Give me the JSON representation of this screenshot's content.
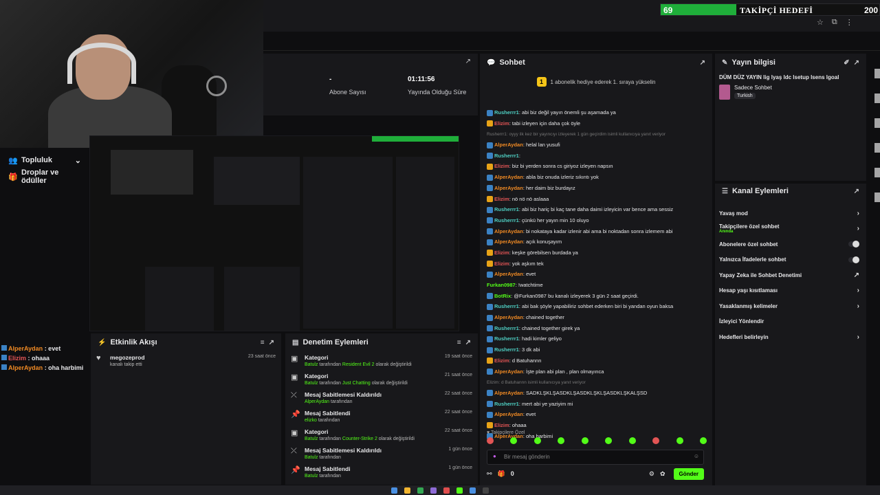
{
  "goal": {
    "current": "69",
    "title": "TAKİPÇİ HEDEFİ",
    "target": "200",
    "progress_fraction": 0.345,
    "color": "#1fae3a"
  },
  "stats": [
    {
      "value": "-",
      "label": "Abone Sayısı"
    },
    {
      "value": "01:11:56",
      "label": "Yayında Olduğu Süre"
    }
  ],
  "nav": {
    "community": "Topluluk",
    "drops": "Droplar ve ödüller"
  },
  "overlay_chat": [
    {
      "user": "AlperAydan",
      "text": " : evet",
      "color": "#f08a24"
    },
    {
      "user": "Elizim",
      "text": " : ohaaa",
      "color": "#e25555"
    },
    {
      "user": "AlperAydan",
      "text": " : oha harbimi",
      "color": "#f08a24"
    }
  ],
  "activity": {
    "title": "Etkinlik Akışı",
    "items": [
      {
        "user": "megozeprod",
        "desc": "kanalı takip etti",
        "time": "23 saat önce"
      }
    ]
  },
  "modlog": {
    "title": "Denetim Eylemleri",
    "items": [
      {
        "icon": "folder-icon",
        "title": "Kategori",
        "who": "Batulz",
        "mid": " tarafından ",
        "hl": "Resident Evil 2",
        "end": " olarak değiştirildi",
        "time": "19 saat önce"
      },
      {
        "icon": "folder-icon",
        "title": "Kategori",
        "who": "Batulz",
        "mid": " tarafından ",
        "hl": "Just Chatting",
        "end": " olarak değiştirildi",
        "time": "21 saat önce"
      },
      {
        "icon": "unpin-icon",
        "title": "Mesaj Sabitlemesi Kaldırıldı",
        "who": "AlperAydan",
        "mid": " tarafından",
        "hl": "",
        "end": "",
        "time": "22 saat önce"
      },
      {
        "icon": "pin-icon",
        "title": "Mesaj Sabitlendi",
        "who": "elizko",
        "mid": " tarafından",
        "hl": "",
        "end": "",
        "time": "22 saat önce"
      },
      {
        "icon": "folder-icon",
        "title": "Kategori",
        "who": "Batulz",
        "mid": " tarafından ",
        "hl": "Counter-Strike 2",
        "end": " olarak değiştirildi",
        "time": "22 saat önce"
      },
      {
        "icon": "unpin-icon",
        "title": "Mesaj Sabitlemesi Kaldırıldı",
        "who": "Batulz",
        "mid": " tarafından",
        "hl": "",
        "end": "",
        "time": "1 gün önce"
      },
      {
        "icon": "pin-icon",
        "title": "Mesaj Sabitlendi",
        "who": "Batulz",
        "mid": " tarafından",
        "hl": "",
        "end": "",
        "time": "1 gün önce"
      }
    ]
  },
  "chat": {
    "title": "Sohbet",
    "pinned_num": "1",
    "pinned_text": "1 abonelik hediye ederek 1. sıraya yükselin",
    "messages": [
      {
        "user": "Rusherrr1",
        "text": ": abi biz değil yayın önemli şu aşamada ya",
        "color": "#4fd1c5",
        "badge": "b"
      },
      {
        "user": "Elizim",
        "text": ": tabi izleyen için daha çok öyle",
        "color": "#e25555",
        "badge": "g"
      },
      {
        "sys": "Rusherrr1: oyyy ilk kez bir yayıncıyı izleyerek 1 gün geçirdim isimli kullanıcıya yanıt veriyor"
      },
      {
        "user": "AlperAydan",
        "text": ": helal lan yusufi",
        "color": "#f08a24",
        "badge": "b"
      },
      {
        "user": "Rusherrr1",
        "text": ":",
        "color": "#4fd1c5",
        "badge": "b"
      },
      {
        "user": "Elizim",
        "text": ": biz bi yerden sonra cs giriyoz izleyen napsın",
        "color": "#e25555",
        "badge": "g"
      },
      {
        "user": "AlperAydan",
        "text": ": abla biz onuda izleriz sıkıntı yok",
        "color": "#f08a24",
        "badge": "b"
      },
      {
        "user": "AlperAydan",
        "text": ": her daim biz burdayız",
        "color": "#f08a24",
        "badge": "b"
      },
      {
        "user": "Elizim",
        "text": ": nö nö nö aslaaa",
        "color": "#e25555",
        "badge": "g"
      },
      {
        "user": "Rusherrr1",
        "text": ": abi biz hariç bi kaç tane daha daimi izleyicin var bence ama sessiz",
        "color": "#4fd1c5",
        "badge": "b"
      },
      {
        "user": "Rusherrr1",
        "text": ": çünkü her yayın min 10 oluyo",
        "color": "#4fd1c5",
        "badge": "b"
      },
      {
        "user": "AlperAydan",
        "text": ": bi nokataya kadar izlenir abi ama bi noktadan sonra izlemem abi",
        "color": "#f08a24",
        "badge": "b"
      },
      {
        "user": "AlperAydan",
        "text": ": açık konuşayım",
        "color": "#f08a24",
        "badge": "b"
      },
      {
        "user": "Elizim",
        "text": ": keşke görebilsen burdada ya",
        "color": "#e25555",
        "badge": "g"
      },
      {
        "user": "Elizim",
        "text": ": yok aşkım tek",
        "color": "#e25555",
        "badge": "g"
      },
      {
        "user": "AlperAydan",
        "text": ": evet",
        "color": "#f08a24",
        "badge": "b"
      },
      {
        "user": "Furkan0987",
        "text": ": !watchtime",
        "color": "#53fc18",
        "badge": ""
      },
      {
        "user": "BotRix",
        "text": ": @Furkan0987 bu kanalı izleyerek 3 gün 2 saat geçirdi.",
        "color": "#53fc18",
        "badge": "b"
      },
      {
        "user": "Rusherrr1",
        "text": ": abi bak şöyle yapabiliriz sohbet ederken biri bi yandan oyun baksa",
        "color": "#4fd1c5",
        "badge": "b"
      },
      {
        "user": "AlperAydan",
        "text": ": chained together",
        "color": "#f08a24",
        "badge": "b"
      },
      {
        "user": "Rusherrr1",
        "text": ": chained together girek ya",
        "color": "#4fd1c5",
        "badge": "b"
      },
      {
        "user": "Rusherrr1",
        "text": ": hadi kimler geliyo",
        "color": "#4fd1c5",
        "badge": "b"
      },
      {
        "user": "Rusherrr1",
        "text": ": 3 dk abi",
        "color": "#4fd1c5",
        "badge": "b"
      },
      {
        "user": "Elizim",
        "text": ": d Batuhannn",
        "color": "#e25555",
        "badge": "g"
      },
      {
        "user": "AlperAydan",
        "text": ": İşte plan abi plan , plan olmayınca",
        "color": "#f08a24",
        "badge": "b"
      },
      {
        "sys": "Elizim: d Batuhannn isimli kullanıcıya yanıt veriyor"
      },
      {
        "user": "AlperAydan",
        "text": ": SADKLŞKLŞASDKLŞASDKLŞKLŞASDKLŞKALŞSD",
        "color": "#f08a24",
        "badge": "b"
      },
      {
        "user": "Rusherrr1",
        "text": ": mert abi ye yaziyim mi",
        "color": "#4fd1c5",
        "badge": "b"
      },
      {
        "user": "AlperAydan",
        "text": ": evet",
        "color": "#f08a24",
        "badge": "b"
      },
      {
        "user": "Elizim",
        "text": ": ohaaa",
        "color": "#e25555",
        "badge": "g"
      },
      {
        "user": "AlperAydan",
        "text": ": oha harbimi",
        "color": "#f08a24",
        "badge": "b"
      }
    ],
    "followers_only": "Takipçilere Özel",
    "input_placeholder": "Bir mesaj gönderin",
    "count": "0",
    "send": "Gönder"
  },
  "info": {
    "title": "Yayın bilgisi",
    "stream_title": "DÜM DÜZ YAYIN lig lyaş ldc lsetup lsens lgoal",
    "category": "Sadece Sohbet",
    "language": "Turkish"
  },
  "actions": {
    "title": "Kanal Eylemleri",
    "items": [
      {
        "label": "Yavaş mod",
        "control": "chevron",
        "sub": ""
      },
      {
        "label": "Takipçilere özel sohbet",
        "control": "chevron",
        "sub": "Anında"
      },
      {
        "label": "Abonelere özel sohbet",
        "control": "toggle",
        "sub": ""
      },
      {
        "label": "Yalnızca İfadelerle sohbet",
        "control": "toggle",
        "sub": ""
      },
      {
        "label": "Yapay Zeka ile Sohbet Denetimi",
        "control": "external",
        "sub": ""
      },
      {
        "label": "Hesap yaşı kısıtlaması",
        "control": "chevron",
        "sub": ""
      },
      {
        "label": "Yasaklanmış kelimeler",
        "control": "chevron",
        "sub": ""
      },
      {
        "label": "İzleyici Yönlendir",
        "control": "none",
        "sub": ""
      },
      {
        "label": "Hedefleri belirleyin",
        "control": "chevron",
        "sub": ""
      }
    ]
  }
}
